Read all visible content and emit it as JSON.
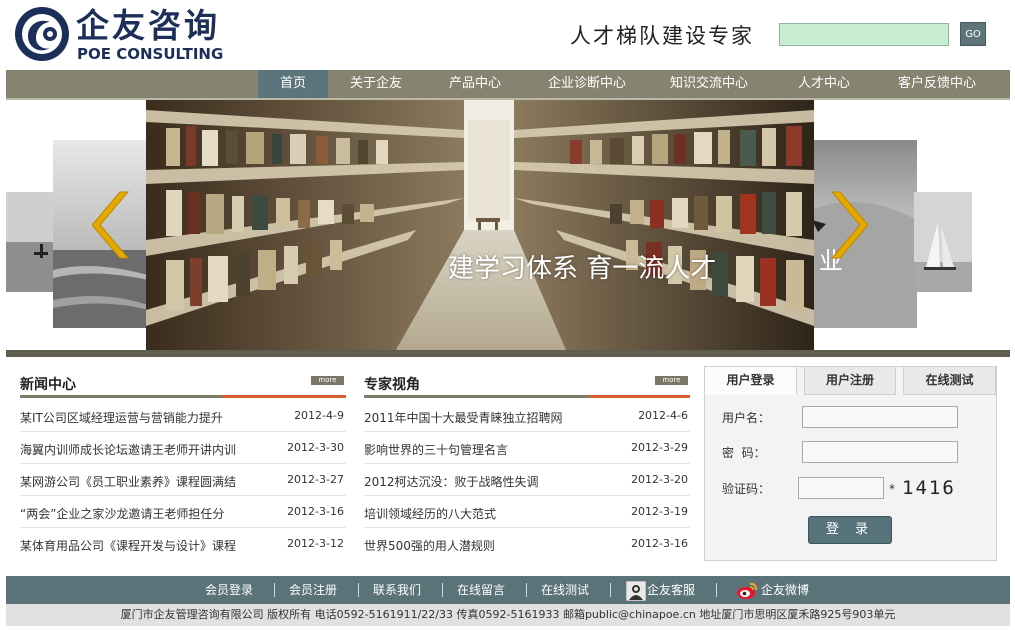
{
  "header": {
    "logo_cn": "企友咨询",
    "logo_en": "POE CONSULTING",
    "slogan": "人才梯队建设专家",
    "search": {
      "value": "",
      "button": "GO"
    }
  },
  "nav": {
    "items": [
      {
        "label": "首页",
        "active": true
      },
      {
        "label": "关于企友",
        "active": false
      },
      {
        "label": "产品中心",
        "active": false
      },
      {
        "label": "企业诊断中心",
        "active": false
      },
      {
        "label": "知识交流中心",
        "active": false
      },
      {
        "label": "人才中心",
        "active": false
      },
      {
        "label": "客户反馈中心",
        "active": false
      }
    ]
  },
  "banner": {
    "caption": "建学习体系 育一流人才",
    "side_caption": "业"
  },
  "news": {
    "title": "新闻中心",
    "more": "more",
    "items": [
      {
        "title": "某IT公司区域经理运营与营销能力提升",
        "date": "2012-4-9"
      },
      {
        "title": "海翼内训师成长论坛邀请王老师开讲内训",
        "date": "2012-3-30"
      },
      {
        "title": "某网游公司《员工职业素养》课程圆满结",
        "date": "2012-3-27"
      },
      {
        "title": "“两会”企业之家沙龙邀请王老师担任分",
        "date": "2012-3-16"
      },
      {
        "title": "某体育用品公司《课程开发与设计》课程",
        "date": "2012-3-12"
      }
    ]
  },
  "expert": {
    "title": "专家视角",
    "more": "more",
    "items": [
      {
        "title": "2011年中国十大最受青睐独立招聘网",
        "date": "2012-4-6"
      },
      {
        "title": "影响世界的三十句管理名言",
        "date": "2012-3-29"
      },
      {
        "title": "2012柯达沉没：败于战略性失调",
        "date": "2012-3-20"
      },
      {
        "title": "培训领域经历的八大范式",
        "date": "2012-3-19"
      },
      {
        "title": "世界500强的用人潜规则",
        "date": "2012-3-16"
      }
    ]
  },
  "login": {
    "tabs": [
      {
        "label": "用户登录",
        "active": true
      },
      {
        "label": "用户注册",
        "active": false
      },
      {
        "label": "在线测试",
        "active": false
      }
    ],
    "username_label": "用户名：",
    "password_label": "密  码：",
    "captcha_label": "验证码：",
    "username_value": "",
    "password_value": "",
    "captcha_input_value": "",
    "captcha_required": "*",
    "captcha_code": "1416",
    "submit": "登 录"
  },
  "footer": {
    "links": [
      {
        "label": "会员登录",
        "icon": null
      },
      {
        "label": "会员注册",
        "icon": null
      },
      {
        "label": "联系我们",
        "icon": null
      },
      {
        "label": "在线留言",
        "icon": null
      },
      {
        "label": "在线测试",
        "icon": null
      },
      {
        "label": "企友客服",
        "icon": "customer-service-icon"
      },
      {
        "label": "企友微博",
        "icon": "weibo-icon"
      }
    ],
    "info": "厦门市企友管理咨询有限公司 版权所有 电话0592-5161911/22/33 传真0592-5161933 邮箱public@chinapoe.cn 地址厦门市思明区厦禾路925号903单元"
  },
  "colors": {
    "nav_bg": "#868470",
    "nav_active": "#5c747c",
    "footer_bg": "#597378",
    "logo": "#1b2f59",
    "arrow": "#e5a800"
  }
}
